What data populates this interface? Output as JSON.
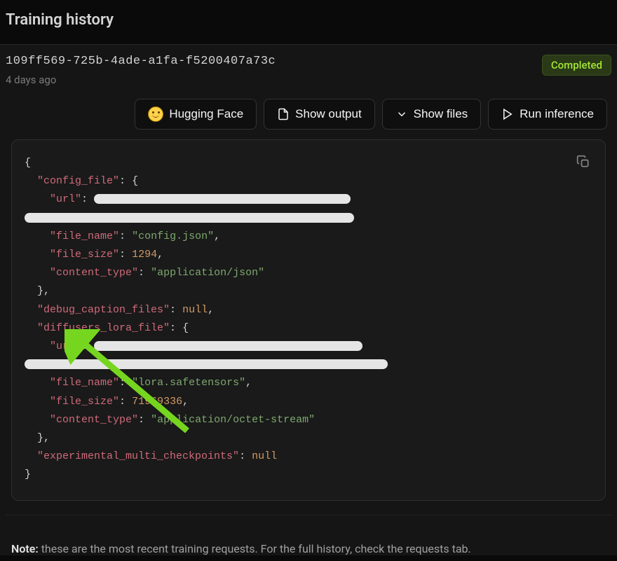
{
  "pageTitle": "Training history",
  "job": {
    "id": "109ff569-725b-4ade-a1fa-f5200407a73c",
    "timeAgo": "4 days ago",
    "status": "Completed"
  },
  "buttons": {
    "huggingFace": "Hugging Face",
    "showOutput": "Show output",
    "showFiles": "Show files",
    "runInference": "Run inference"
  },
  "code": {
    "configFileKey": "\"config_file\"",
    "urlKey": "\"url\"",
    "fileNameKey": "\"file_name\"",
    "fileSizeKey": "\"file_size\"",
    "contentTypeKey": "\"content_type\"",
    "debugCaptionFilesKey": "\"debug_caption_files\"",
    "diffusersLoraFileKey": "\"diffusers_lora_file\"",
    "experimentalMultiCheckpointsKey": "\"experimental_multi_checkpoints\"",
    "configJson": "\"config.json\"",
    "size1": "1294",
    "appJson": "\"application/json\"",
    "loraSafetensors": "\"lora.safetensors\"",
    "size2partial": "71969336",
    "appOctet": "\"application/octet-stream\"",
    "nullVal": "null",
    "colon": ": ",
    "comma": ",",
    "openBrace": "{",
    "closeBrace": "}",
    "closeBraceComma": "},"
  },
  "note": {
    "bold": "Note:",
    "text": " these are the most recent training requests. For the full history, check the requests tab."
  }
}
